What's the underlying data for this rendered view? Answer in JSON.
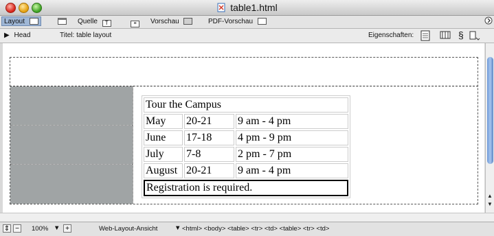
{
  "window": {
    "title": "table1.html"
  },
  "toolbar": {
    "layout_label": "Layout",
    "source_label": "Quelle",
    "preview_label": "Vorschau",
    "pdf_preview_label": "PDF-Vorschau"
  },
  "head_bar": {
    "head_label": "Head",
    "title_label": "Titel:",
    "title_value": "table layout",
    "properties_label": "Eigenschaften:"
  },
  "content": {
    "table_rows": [
      [
        "Tour the Campus"
      ],
      [
        "May",
        "20-21",
        "9 am - 4 pm"
      ],
      [
        "June",
        "17-18",
        "4 pm - 9 pm"
      ],
      [
        "July",
        "7-8",
        "2 pm - 7 pm"
      ],
      [
        "August",
        "20-21",
        "9 am - 4 pm"
      ],
      [
        "Registration is required."
      ]
    ]
  },
  "status": {
    "zoom": "100%",
    "view_mode": "Web-Layout-Ansicht",
    "breadcrumb": "<html> <body> <table> <tr> <td> <table> <tr> <td>"
  }
}
